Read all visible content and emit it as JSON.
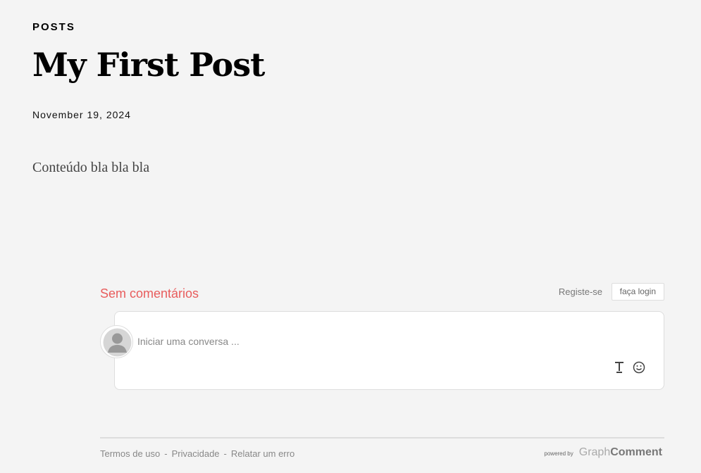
{
  "post": {
    "section_label": "POSTS",
    "title": "My First Post",
    "date": "November 19, 2024",
    "body": "Conteúdo bla bla bla"
  },
  "comments": {
    "count_label": "Sem comentários",
    "register_label": "Registe-se",
    "login_label": "faça login",
    "input_placeholder": "Iniciar uma conversa ...",
    "input_value": "",
    "accent_color": "#e85c5c",
    "tools": [
      "text-format-icon",
      "emoji-icon"
    ]
  },
  "footer": {
    "links": [
      "Termos de uso",
      "Privacidade",
      "Relatar um erro"
    ],
    "separator": "-",
    "powered_by": "powered by",
    "brand_light": "Graph",
    "brand_bold": "Comment"
  }
}
